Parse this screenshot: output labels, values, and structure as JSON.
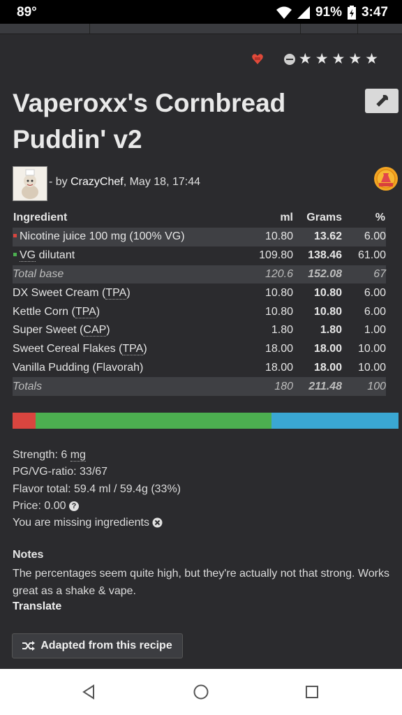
{
  "status": {
    "temp": "89°",
    "battery": "91%",
    "time": "3:47"
  },
  "recipe": {
    "title_line1": "Vaperoxx's Cornbread",
    "title_line2": "Puddin' v2",
    "by_prefix": "- by ",
    "author": "CrazyChef",
    "date": ", May 18, 17:44"
  },
  "table": {
    "headers": {
      "ingredient": "Ingredient",
      "ml": "ml",
      "grams": "Grams",
      "pct": "%"
    },
    "rows": [
      {
        "name": "Nicotine juice 100 mg (100% VG)",
        "ml": "10.80",
        "grams": "13.62",
        "pct": "6.00"
      },
      {
        "name_pre": "",
        "abbr": "VG",
        "name_post": " dilutant",
        "ml": "109.80",
        "grams": "138.46",
        "pct": "61.00"
      },
      {
        "name": "Total base",
        "ml": "120.6",
        "grams": "152.08",
        "pct": "67"
      },
      {
        "name_pre": "DX Sweet Cream (",
        "abbr": "TPA",
        "name_post": ")",
        "ml": "10.80",
        "grams": "10.80",
        "pct": "6.00"
      },
      {
        "name_pre": "Kettle Corn (",
        "abbr": "TPA",
        "name_post": ")",
        "ml": "10.80",
        "grams": "10.80",
        "pct": "6.00"
      },
      {
        "name_pre": "Super Sweet (",
        "abbr": "CAP",
        "name_post": ")",
        "ml": "1.80",
        "grams": "1.80",
        "pct": "1.00"
      },
      {
        "name_pre": "Sweet Cereal Flakes (",
        "abbr": "TPA",
        "name_post": ")",
        "ml": "18.00",
        "grams": "18.00",
        "pct": "10.00"
      },
      {
        "name": "Vanilla Pudding (Flavorah)",
        "ml": "18.00",
        "grams": "18.00",
        "pct": "10.00"
      },
      {
        "name": "Totals",
        "ml": "180",
        "grams": "211.48",
        "pct": "100"
      }
    ]
  },
  "ratio_bar": {
    "segments": [
      {
        "pct": 6,
        "color": "#d9453f"
      },
      {
        "pct": 61,
        "color": "#4caf50"
      },
      {
        "pct": 33,
        "color": "#3aa7d3"
      }
    ]
  },
  "info": {
    "strength_label": "Strength: 6 ",
    "strength_unit": "mg",
    "pgvg": "PG/VG-ratio: 33/67",
    "flavor_total": "Flavor total: 59.4 ml / 59.4g (33%)",
    "price": "Price: 0.00",
    "missing": "You are missing ingredients"
  },
  "notes": {
    "heading": "Notes",
    "text": "The percentages seem quite high, but they're actually not that strong. Works great as a shake & vape.",
    "translate": "Translate"
  },
  "adapted_label": "Adapted from this recipe",
  "colors": {
    "nic_marker": "#d9453f",
    "vg_marker": "#4caf50"
  }
}
